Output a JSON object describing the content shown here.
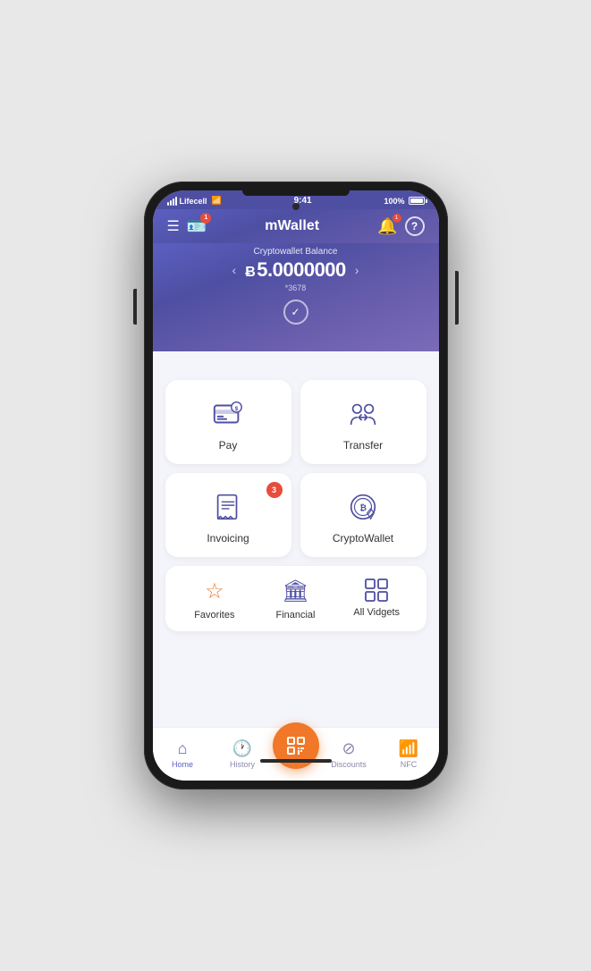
{
  "status": {
    "carrier": "Lifecell",
    "time": "9:41",
    "battery": "100%"
  },
  "header": {
    "title": "mWallet",
    "card_badge": "1",
    "bell_badge": "1",
    "help_label": "?"
  },
  "balance": {
    "label": "Cryptowallet Balance",
    "symbol": "Ƀ",
    "amount": "5.0000000",
    "account": "*3678"
  },
  "actions": [
    {
      "id": "pay",
      "label": "Pay",
      "badge": null
    },
    {
      "id": "transfer",
      "label": "Transfer",
      "badge": null
    },
    {
      "id": "invoicing",
      "label": "Invoicing",
      "badge": "3"
    },
    {
      "id": "cryptowallet",
      "label": "CryptoWallet",
      "badge": null
    }
  ],
  "widgets": [
    {
      "id": "favorites",
      "label": "Favorites",
      "icon": "★",
      "color": "orange"
    },
    {
      "id": "financial",
      "label": "Financial",
      "icon": "🏛",
      "color": "blue"
    },
    {
      "id": "all-vidgets",
      "label": "All Vidgets",
      "icon": "⊞",
      "color": "blue"
    }
  ],
  "nav": [
    {
      "id": "home",
      "label": "Home",
      "active": true
    },
    {
      "id": "history",
      "label": "History",
      "active": false
    },
    {
      "id": "scan",
      "label": "",
      "active": false,
      "is_scan": true
    },
    {
      "id": "discounts",
      "label": "Discounts",
      "active": false
    },
    {
      "id": "nfc",
      "label": "NFC",
      "active": false
    }
  ]
}
